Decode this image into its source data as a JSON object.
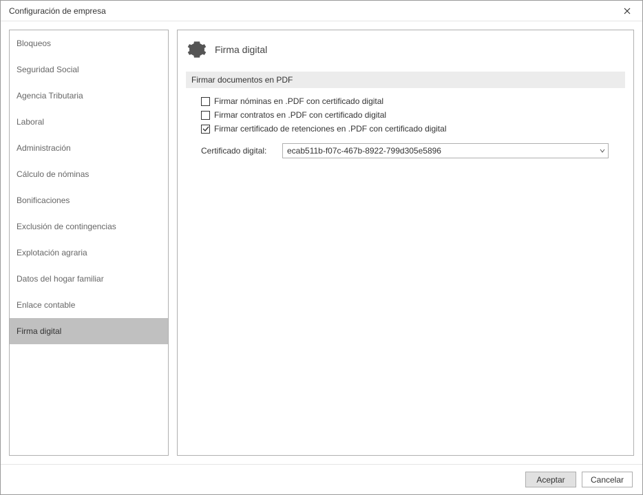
{
  "window": {
    "title": "Configuración de empresa"
  },
  "sidebar": {
    "items": [
      {
        "label": "Bloqueos"
      },
      {
        "label": "Seguridad Social"
      },
      {
        "label": "Agencia Tributaria"
      },
      {
        "label": "Laboral"
      },
      {
        "label": "Administración"
      },
      {
        "label": "Cálculo de nóminas"
      },
      {
        "label": "Bonificaciones"
      },
      {
        "label": "Exclusión de contingencias"
      },
      {
        "label": "Explotación agraria"
      },
      {
        "label": "Datos del hogar familiar"
      },
      {
        "label": "Enlace contable"
      },
      {
        "label": "Firma digital"
      }
    ],
    "selected_index": 11
  },
  "panel": {
    "title": "Firma digital",
    "section_title": "Firmar documentos en PDF",
    "checkboxes": [
      {
        "label": "Firmar nóminas en .PDF con certificado digital",
        "checked": false
      },
      {
        "label": "Firmar contratos en .PDF con certificado digital",
        "checked": false
      },
      {
        "label": "Firmar certificado de retenciones en .PDF con certificado digital",
        "checked": true
      }
    ],
    "cert_label": "Certificado digital:",
    "cert_value": "ecab511b-f07c-467b-8922-799d305e5896"
  },
  "footer": {
    "accept": "Aceptar",
    "cancel": "Cancelar"
  }
}
